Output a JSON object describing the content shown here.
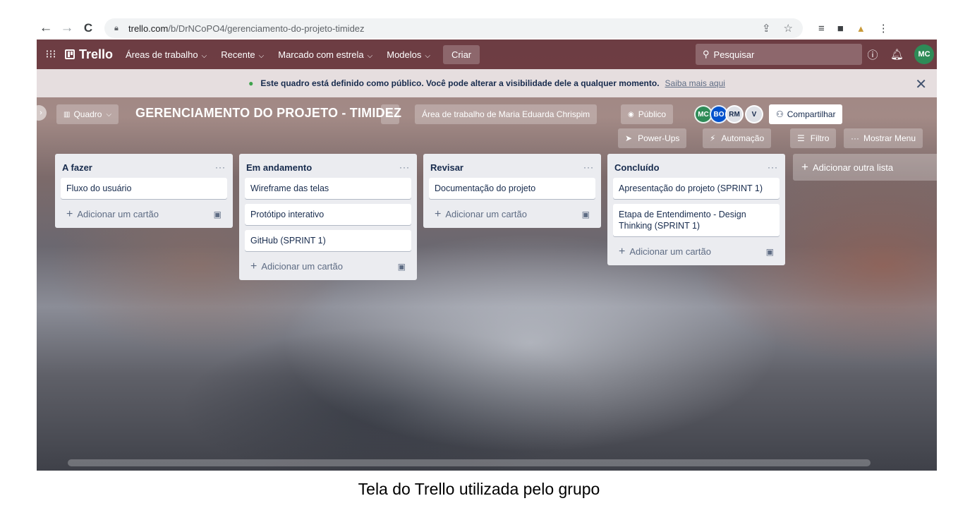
{
  "browser": {
    "url_host": "trello.com",
    "url_path": "/b/DrNCoPO4/gerenciamento-do-projeto-timidez",
    "icons": [
      "back-arrow-icon",
      "forward-arrow-icon",
      "reload-icon",
      "lock-icon",
      "share-icon",
      "bookmark-star-icon",
      "reading-list-icon",
      "side-panel-icon",
      "extension-icon",
      "kebab-menu-icon"
    ]
  },
  "header": {
    "logo": "Trello",
    "menus": [
      "Áreas de trabalho",
      "Recente",
      "Marcado com estrela",
      "Modelos"
    ],
    "create": "Criar",
    "search_placeholder": "Pesquisar",
    "user_initials": "MC"
  },
  "banner": {
    "message": "Este quadro está definido como público. Você pode alterar a visibilidade dele a qualquer momento.",
    "link": "Saiba mais aqui"
  },
  "board": {
    "view": "Quadro",
    "title": "GERENCIAMENTO DO PROJETO - TIMIDEZ",
    "workspace": "Área de trabalho de Maria Eduarda Chrispim",
    "visibility": "Público",
    "members": [
      {
        "initials": "MC",
        "color": "#2e8b57"
      },
      {
        "initials": "BO",
        "color": "#0052cc"
      },
      {
        "initials": "RM",
        "color": "#dfe1e6"
      },
      {
        "initials": "V",
        "color": "#dfe1e6"
      }
    ],
    "share": "Compartilhar",
    "power_ups": "Power-Ups",
    "automation": "Automação",
    "filter": "Filtro",
    "show_menu": "Mostrar Menu"
  },
  "lists": [
    {
      "title": "A fazer",
      "cards": [
        "Fluxo do usuário"
      ],
      "add_card": "Adicionar um cartão"
    },
    {
      "title": "Em andamento",
      "cards": [
        "Wireframe das telas",
        "Protótipo interativo",
        "GitHub (SPRINT 1)"
      ],
      "add_card": "Adicionar um cartão"
    },
    {
      "title": "Revisar",
      "cards": [
        "Documentação do projeto"
      ],
      "add_card": "Adicionar um cartão"
    },
    {
      "title": "Concluído",
      "cards": [
        "Apresentação do projeto (SPRINT 1)",
        "Etapa de Entendimento - Design Thinking (SPRINT 1)"
      ],
      "add_card": "Adicionar um cartão"
    }
  ],
  "add_list": "Adicionar outra lista",
  "caption": "Tela do Trello utilizada pelo grupo"
}
